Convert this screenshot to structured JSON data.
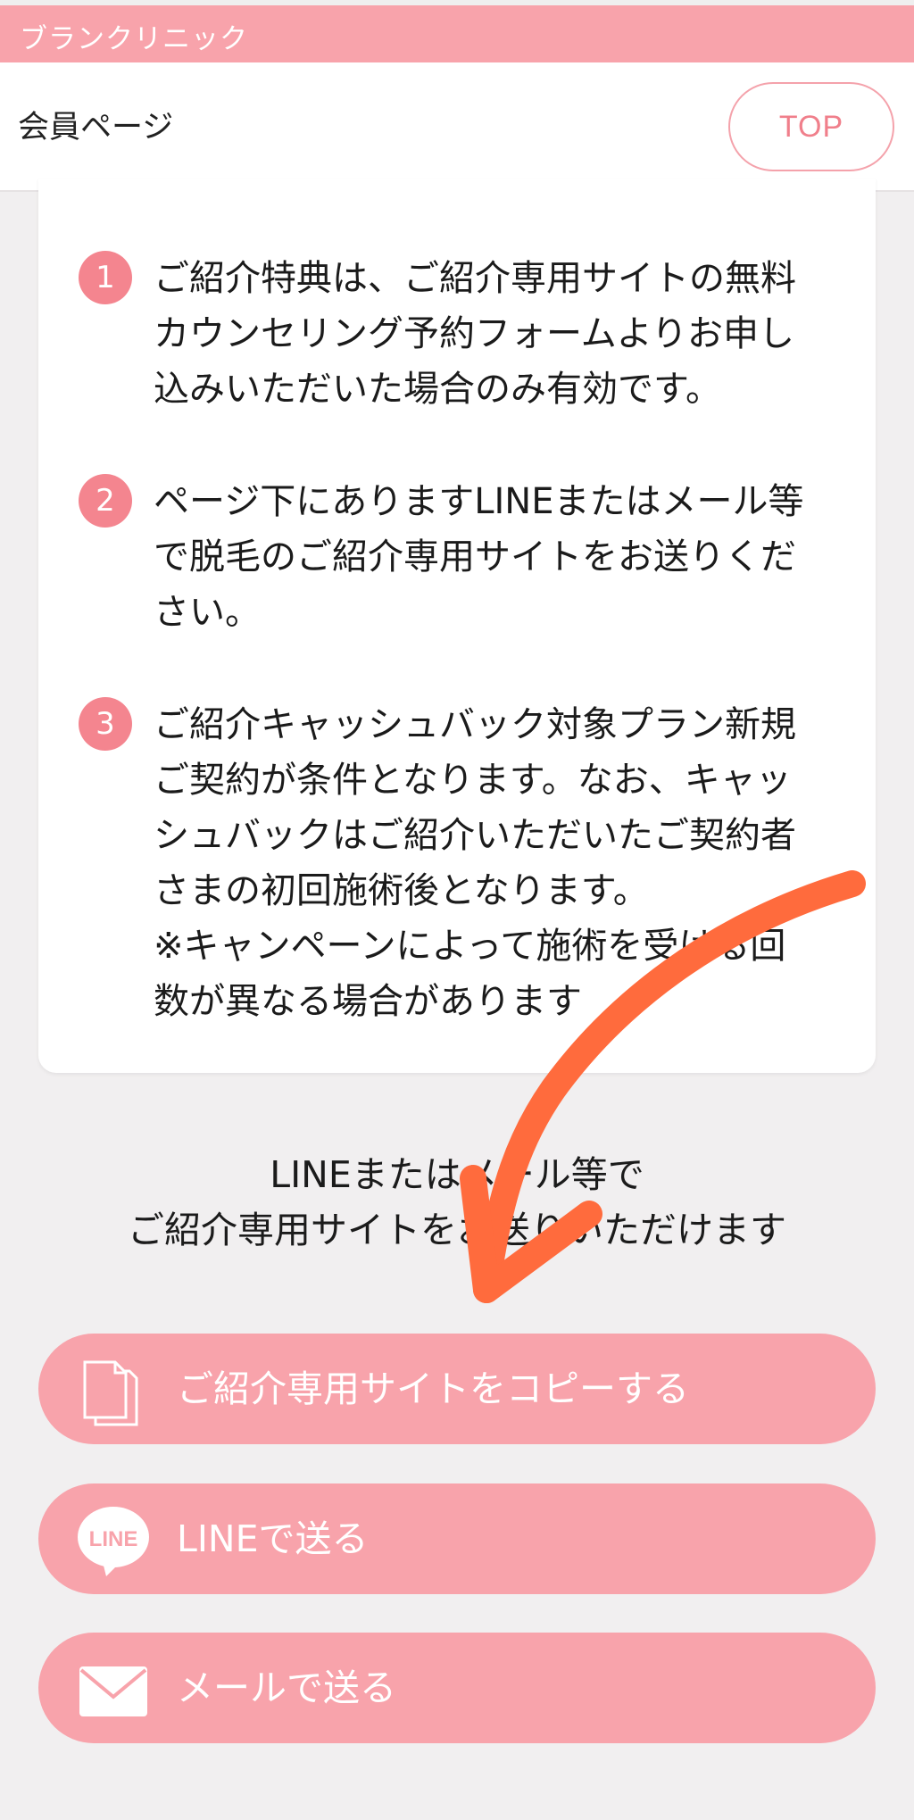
{
  "topbar": {
    "brand": "ブランクリニック"
  },
  "header": {
    "title": "会員ページ",
    "top_button": "TOP"
  },
  "notes": [
    {
      "number": "1",
      "text": "ご紹介特典は、ご紹介専用サイトの無料\nカウンセリング予約フォームよりお申し\n込みいただいた場合のみ有効です。"
    },
    {
      "number": "2",
      "text": "ページ下にありますLINEまたはメール等\nで脱毛のご紹介専用サイトをお送りくだ\nさい。"
    },
    {
      "number": "3",
      "text": "ご紹介キャッシュバック対象プラン新規\nご契約が条件となります。なお、キャッ\nシュバックはご紹介いただいたご契約者\nさまの初回施術後となります。\n※キャンペーンによって施術を受ける回\n数が異なる場合があります"
    }
  ],
  "share_text": "LINEまたはメール等で\nご紹介専用サイトをお送りいただけます",
  "buttons": {
    "copy": "ご紹介専用サイトをコピーする",
    "line": "LINEで送る",
    "mail": "メールで送る",
    "line_icon_text": "LINE"
  },
  "colors": {
    "accent": "#f8a3ab",
    "badge": "#f4858f",
    "annotation_arrow": "#ff6b3d"
  },
  "icons": [
    "copy-icon",
    "line-icon",
    "mail-icon"
  ]
}
